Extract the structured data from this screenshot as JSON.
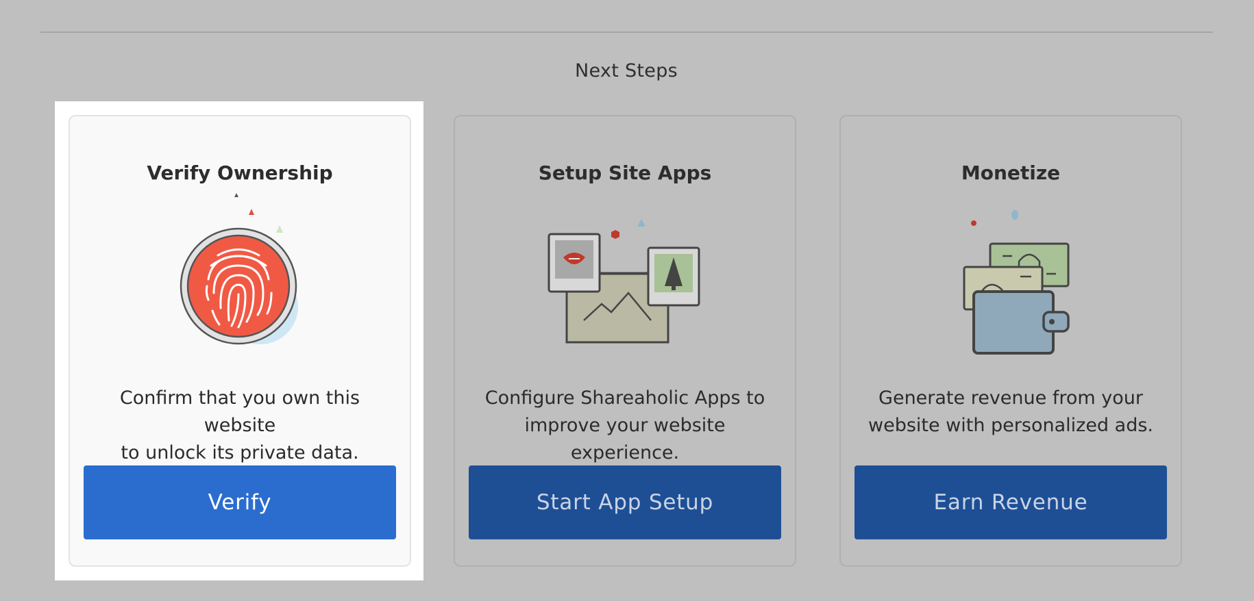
{
  "section": {
    "title": "Next Steps"
  },
  "cards": [
    {
      "title": "Verify Ownership",
      "icon": "fingerprint-icon",
      "description_line1": "Confirm that you own this website",
      "description_line2": "to unlock its private data.",
      "button_label": "Verify",
      "active": true
    },
    {
      "title": "Setup Site Apps",
      "icon": "photo-apps-icon",
      "description_line1": "Configure Shareaholic Apps to",
      "description_line2": "improve your website experience.",
      "button_label": "Start App Setup",
      "active": false
    },
    {
      "title": "Monetize",
      "icon": "wallet-money-icon",
      "description_line1": "Generate revenue from your",
      "description_line2": "website with personalized ads.",
      "button_label": "Earn Revenue",
      "active": false
    }
  ],
  "colors": {
    "overlay_bg": "#bfbfbf",
    "primary_button": "#2b6dcf",
    "dimmed_button": "#1e4f95",
    "fingerprint_red": "#f05a45"
  }
}
